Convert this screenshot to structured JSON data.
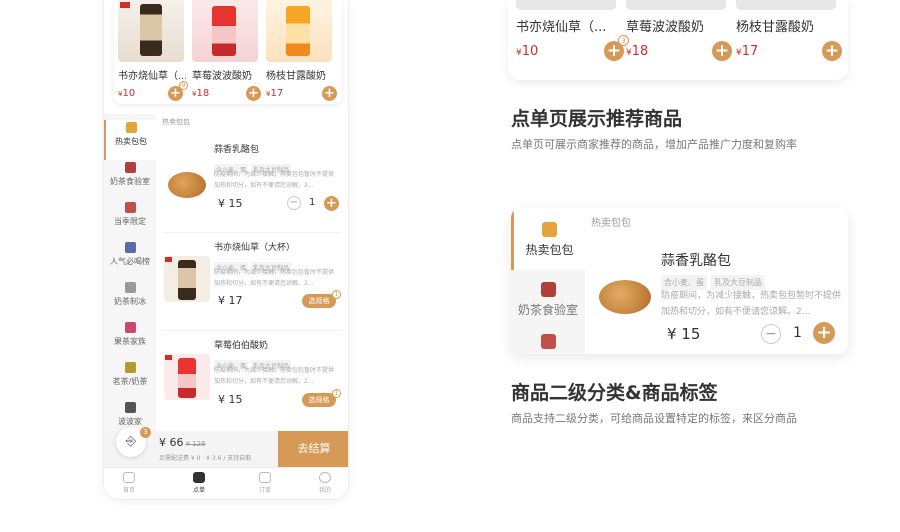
{
  "phone": {
    "recommend": [
      {
        "name": "书亦烧仙草（...",
        "price": "10",
        "currency": "¥",
        "badge": "9"
      },
      {
        "name": "草莓波波酸奶",
        "price": "18",
        "currency": "¥"
      },
      {
        "name": "杨枝甘露酸奶",
        "price": "17",
        "currency": "¥"
      }
    ],
    "categories": [
      {
        "label": "热卖包包",
        "icon": "bread-icon",
        "color": "#e1a53b"
      },
      {
        "label": "奶茶食验室",
        "icon": "flask-icon",
        "color": "#b0403c"
      },
      {
        "label": "当季限定",
        "icon": "gift-icon",
        "color": "#c0504a"
      },
      {
        "label": "人气必喝榜",
        "icon": "cup-icon",
        "color": "#5b6aa8"
      },
      {
        "label": "奶茶制冰",
        "icon": "ice-icon",
        "color": "#999999"
      },
      {
        "label": "果茶家族",
        "icon": "fruit-icon",
        "color": "#c94a6e"
      },
      {
        "label": "茗茶/奶茶",
        "icon": "tea-icon",
        "color": "#b59a2c"
      },
      {
        "label": "波波家",
        "icon": "boba-icon",
        "color": "#555555"
      }
    ],
    "section_title": "热卖包包",
    "products": [
      {
        "name": "蒜香乳酪包",
        "tags": [
          "含小麦、蛋",
          "乳及大豆制品"
        ],
        "desc": "防疫期间，为减少接触，热卖包包暂时不提供加热和切分，如有不便请您谅解。2...",
        "price": "15",
        "currency": "¥",
        "qty": "1"
      },
      {
        "name": "书亦烧仙草（大杯）",
        "tags": [
          "含小麦、蛋",
          "乳及大豆制品"
        ],
        "desc": "防疫期间，为减少接触，热卖包包暂时不提供加热和切分，如有不便请您谅解。2...",
        "price": "17",
        "currency": "¥",
        "button": "选规格",
        "badge": "1"
      },
      {
        "name": "草莓伯伯酸奶",
        "tags": [
          "含小麦、蛋",
          "乳及大豆制品"
        ],
        "desc": "防疫期间，为减少接触，热卖包包暂时不提供加热和切分，如有不便请您谅解。2...",
        "price": "15",
        "currency": "¥",
        "button": "选规格",
        "badge": "1"
      }
    ],
    "cart": {
      "badge": "3",
      "total": "¥ 66",
      "original": "¥ 126",
      "note": "另需配送费 ¥ 0 · ¥ 3.6 / 支持自取",
      "checkout": "去结算"
    },
    "tabs": [
      {
        "label": "首页",
        "icon": "home-icon"
      },
      {
        "label": "点单",
        "icon": "drink-icon"
      },
      {
        "label": "订单",
        "icon": "order-icon"
      },
      {
        "label": "我的",
        "icon": "user-icon"
      }
    ]
  },
  "top_card": {
    "items": [
      {
        "name": "书亦烧仙草（...",
        "price": "10",
        "currency": "¥",
        "badge": "3"
      },
      {
        "name": "草莓波波酸奶",
        "price": "18",
        "currency": "¥"
      },
      {
        "name": "杨枝甘露酸奶",
        "price": "17",
        "currency": "¥"
      }
    ]
  },
  "feature1": {
    "title": "点单页展示推荐商品",
    "desc": "点单页可展示商家推荐的商品，增加产品推广力度和复购率"
  },
  "big_card": {
    "categories": [
      {
        "label": "热卖包包",
        "icon": "bread-icon"
      },
      {
        "label": "奶茶食验室",
        "icon": "flask-icon"
      },
      {
        "label": "",
        "icon": "gift-icon"
      }
    ],
    "section_title": "热卖包包",
    "product": {
      "name": "蒜香乳酪包",
      "tags": [
        "含小麦、蛋",
        "乳及大豆制品"
      ],
      "desc": "防疫期间，为减少接触，热卖包包暂时不提供加热和切分，如有不便请您谅解。2...",
      "price": "¥ 15",
      "qty": "1"
    }
  },
  "feature2": {
    "title": "商品二级分类&商品标签",
    "desc": "商品支持二级分类，可给商品设置特定的标签，来区分商品"
  },
  "colors": {
    "accent": "#d69a56",
    "price_red": "#d42b2b"
  }
}
